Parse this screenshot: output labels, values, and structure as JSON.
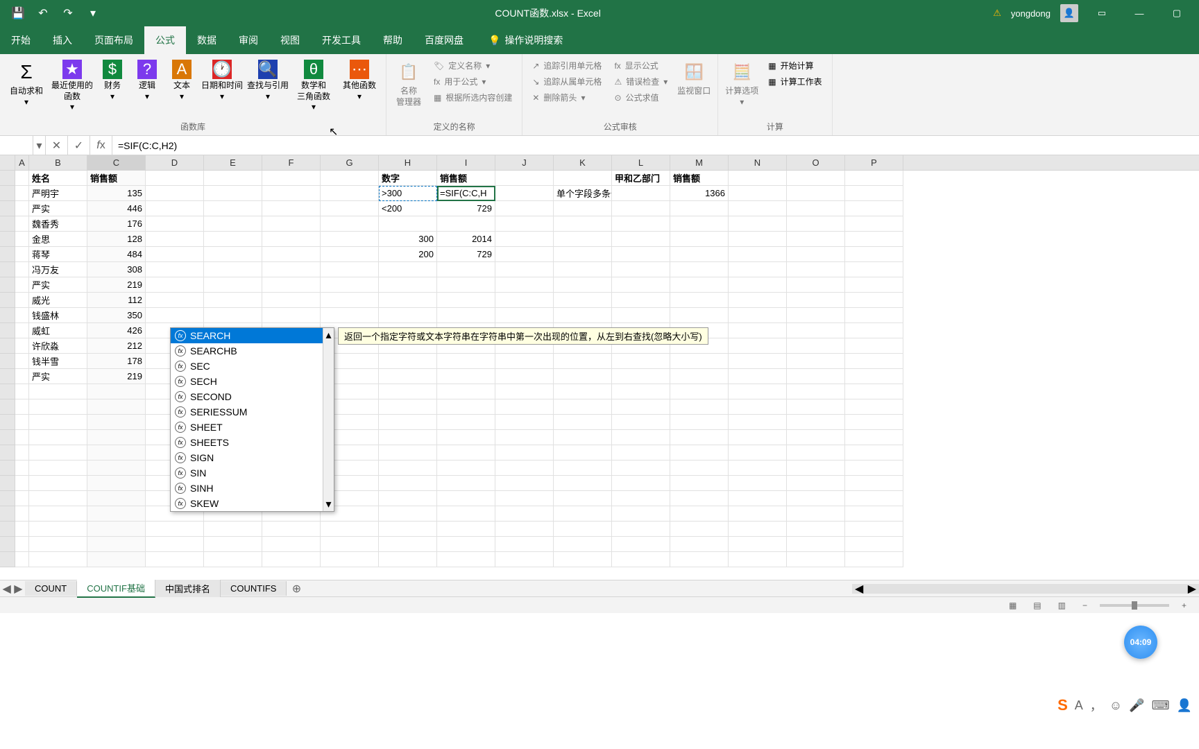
{
  "title": "COUNT函数.xlsx - Excel",
  "user": "yongdong",
  "tabs": [
    "开始",
    "插入",
    "页面布局",
    "公式",
    "数据",
    "审阅",
    "视图",
    "开发工具",
    "帮助",
    "百度网盘"
  ],
  "active_tab": "公式",
  "tellme": "操作说明搜索",
  "ribbon": {
    "fnlib": {
      "autosum": "自动求和",
      "recent": "最近使用的\n函数",
      "financial": "财务",
      "logical": "逻辑",
      "text": "文本",
      "datetime": "日期和时间",
      "lookup": "查找与引用",
      "math": "数学和\n三角函数",
      "other": "其他函数",
      "label": "函数库"
    },
    "names": {
      "mgr": "名称\n管理器",
      "define": "定义名称",
      "use": "用于公式",
      "create": "根据所选内容创建",
      "label": "定义的名称"
    },
    "audit": {
      "precedents": "追踪引用单元格",
      "dependents": "追踪从属单元格",
      "remove": "删除箭头",
      "showf": "显示公式",
      "errchk": "错误检查",
      "eval": "公式求值",
      "watch": "监视窗口",
      "label": "公式审核"
    },
    "calc": {
      "options": "计算选项",
      "now": "开始计算",
      "sheet": "计算工作表",
      "label": "计算"
    }
  },
  "formula_bar": {
    "value": "=SIF(C:C,H2)"
  },
  "columns": [
    "A",
    "B",
    "C",
    "D",
    "E",
    "F",
    "G",
    "H",
    "I",
    "J",
    "K",
    "L",
    "M",
    "N",
    "O",
    "P"
  ],
  "table1": {
    "headers": [
      "姓名",
      "销售额"
    ],
    "rows": [
      [
        "严明宇",
        135
      ],
      [
        "严实",
        446
      ],
      [
        "魏香秀",
        176
      ],
      [
        "金思",
        128
      ],
      [
        "蒋琴",
        484
      ],
      [
        "冯万友",
        308
      ],
      [
        "严实",
        219
      ],
      [
        "威光",
        112
      ],
      [
        "钱盛林",
        350
      ],
      [
        "威虹",
        426
      ],
      [
        "许欣淼",
        212
      ],
      [
        "钱半雪",
        178
      ],
      [
        "严实",
        219
      ]
    ]
  },
  "table2": {
    "headers": [
      "数字",
      "销售额"
    ],
    "rows": [
      [
        ">300",
        "=SIF(C:C,H"
      ],
      [
        "<200",
        "729"
      ]
    ],
    "extra": [
      [
        300,
        2014
      ],
      [
        200,
        729
      ]
    ]
  },
  "label_single": "单个字段多条件",
  "header_dept": "甲和乙部门",
  "header_sales2": "销售额",
  "val_1366": "1366",
  "autocomplete": [
    "SEARCH",
    "SEARCHB",
    "SEC",
    "SECH",
    "SECOND",
    "SERIESSUM",
    "SHEET",
    "SHEETS",
    "SIGN",
    "SIN",
    "SINH",
    "SKEW"
  ],
  "tooltip": "返回一个指定字符或文本字符串在字符串中第一次出现的位置，从左到右查找(忽略大小写)",
  "sheets": [
    "COUNT",
    "COUNTIF基础",
    "中国式排名",
    "COUNTIFS"
  ],
  "active_sheet": "COUNTIF基础",
  "timer": "04:09",
  "zoom_plus": "+",
  "zoom_minus": "−"
}
